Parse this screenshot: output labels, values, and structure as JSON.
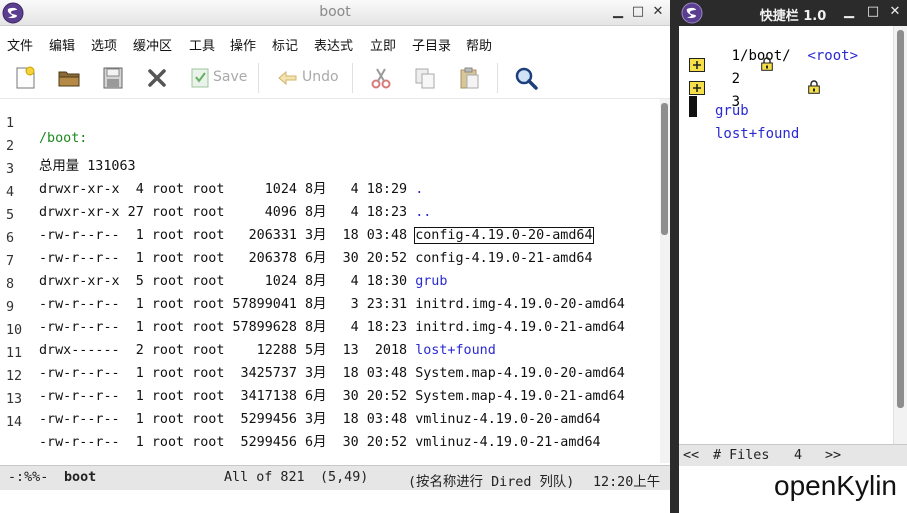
{
  "emacs": {
    "title": "boot",
    "menu": [
      "文件",
      "编辑",
      "选项",
      "缓冲区",
      "工具",
      "操作",
      "标记",
      "表达式",
      "立即",
      "子目录",
      "帮助"
    ],
    "toolbar": {
      "save_label": "Save",
      "undo_label": "Undo"
    },
    "buffer": {
      "lines": [
        {
          "num": "1",
          "text": "/boot:",
          "kind": "header"
        },
        {
          "num": "2",
          "text": "总用量 131063",
          "kind": "plain"
        },
        {
          "num": "3",
          "meta": "drwxr-xr-x  4 root root     1024 8月   4 18:29 ",
          "name": ".",
          "kind": "dir"
        },
        {
          "num": "4",
          "meta": "drwxr-xr-x 27 root root     4096 8月   4 18:23 ",
          "name": "..",
          "kind": "dir"
        },
        {
          "num": "5",
          "meta": "-rw-r--r--  1 root root   206331 3月  18 03:48 ",
          "name": "config-4.19.0-20-amd64",
          "kind": "cursor"
        },
        {
          "num": "6",
          "meta": "-rw-r--r--  1 root root   206378 6月  30 20:52 ",
          "name": "config-4.19.0-21-amd64",
          "kind": "file"
        },
        {
          "num": "7",
          "meta": "drwxr-xr-x  5 root root     1024 8月   4 18:30 ",
          "name": "grub",
          "kind": "dir"
        },
        {
          "num": "8",
          "meta": "-rw-r--r--  1 root root 57899041 8月   3 23:31 ",
          "name": "initrd.img-4.19.0-20-amd64",
          "kind": "file"
        },
        {
          "num": "9",
          "meta": "-rw-r--r--  1 root root 57899628 8月   4 18:23 ",
          "name": "initrd.img-4.19.0-21-amd64",
          "kind": "file"
        },
        {
          "num": "10",
          "meta": "drwx------  2 root root    12288 5月  13  2018 ",
          "name": "lost+found",
          "kind": "dir"
        },
        {
          "num": "11",
          "meta": "-rw-r--r--  1 root root  3425737 3月  18 03:48 ",
          "name": "System.map-4.19.0-20-amd64",
          "kind": "file"
        },
        {
          "num": "12",
          "meta": "-rw-r--r--  1 root root  3417138 6月  30 20:52 ",
          "name": "System.map-4.19.0-21-amd64",
          "kind": "file"
        },
        {
          "num": "13",
          "meta": "-rw-r--r--  1 root root  5299456 3月  18 03:48 ",
          "name": "vmlinuz-4.19.0-20-amd64",
          "kind": "file"
        },
        {
          "num": "14",
          "meta": "-rw-r--r--  1 root root  5299456 6月  30 20:52 ",
          "name": "vmlinuz-4.19.0-21-amd64",
          "kind": "file"
        }
      ]
    },
    "modeline": {
      "status": "-:%%-",
      "buffer_name": "boot",
      "position": "All of 821",
      "cursor": "(5,49)",
      "mode": "(按名称进行 Dired 列队)",
      "time": "12:20上午"
    }
  },
  "speedbar": {
    "title": "快捷栏 1.0",
    "path_prefix": "1",
    "path": "/boot/",
    "root_label": "<root>",
    "items": [
      {
        "num": "2",
        "name": "grub"
      },
      {
        "num": "3",
        "name": "lost+found"
      }
    ],
    "modeline": {
      "left": "<<",
      "label": "# Files",
      "count": "4",
      "right": ">>"
    }
  },
  "brand": "openKylin",
  "colors": {
    "directory": "#2a2ad2",
    "header": "#1e8a1e",
    "modeline_bg": "#e6e6e6",
    "title_dark": "#2b2b2b"
  }
}
